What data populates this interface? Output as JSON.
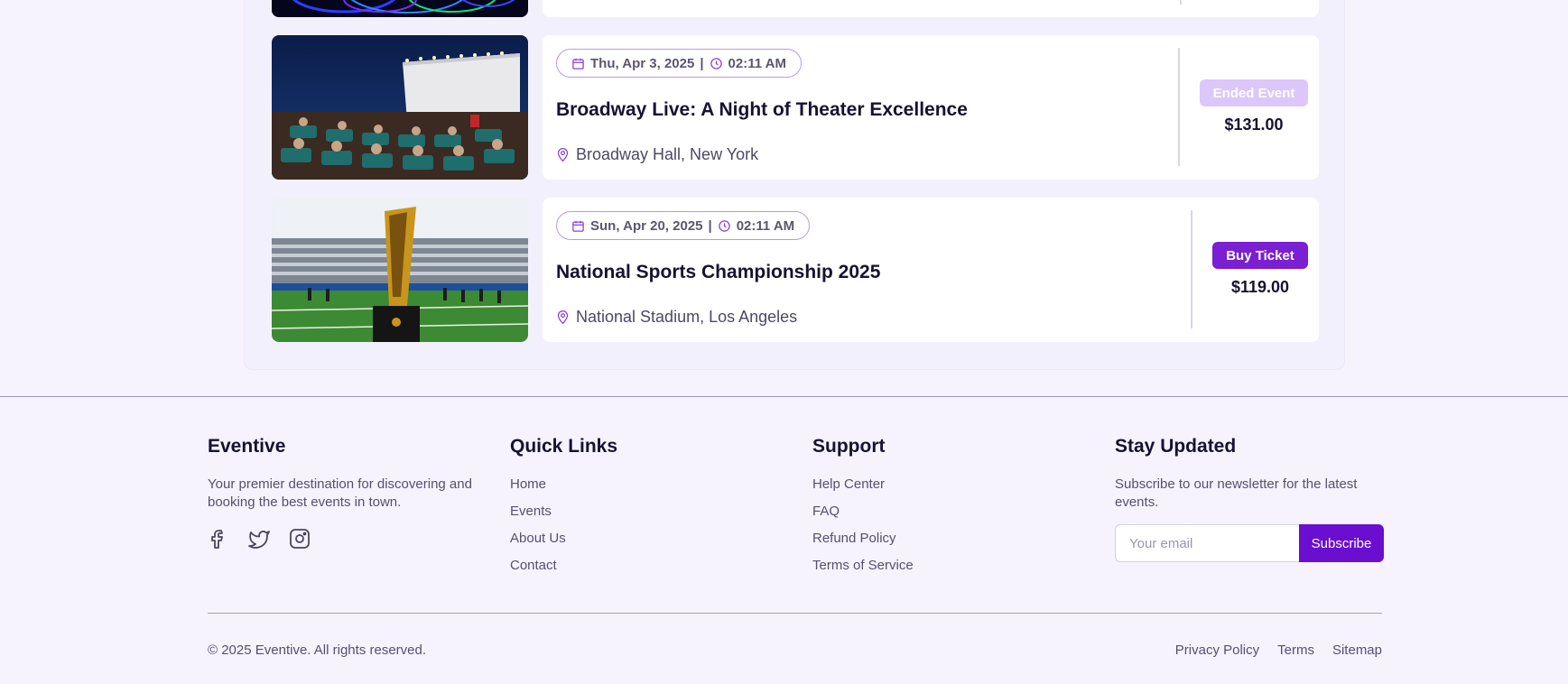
{
  "events": [
    {
      "date": "Thu, Apr 3, 2025",
      "separator": "|",
      "time": "02:11 AM",
      "title": "Broadway Live: A Night of Theater Excellence",
      "location": "Broadway Hall, New York",
      "status_label": "Ended Event",
      "price": "$131.00"
    },
    {
      "date": "Sun, Apr 20, 2025",
      "separator": "|",
      "time": "02:11 AM",
      "title": "National Sports Championship 2025",
      "location": "National Stadium, Los Angeles",
      "status_label": "Buy Ticket",
      "price": "$119.00"
    }
  ],
  "footer": {
    "brand": {
      "title": "Eventive",
      "description": "Your premier destination for discovering and booking the best events in town.",
      "social": [
        "facebook-icon",
        "twitter-icon",
        "instagram-icon"
      ]
    },
    "quick_links": {
      "title": "Quick Links",
      "items": [
        "Home",
        "Events",
        "About Us",
        "Contact"
      ]
    },
    "support": {
      "title": "Support",
      "items": [
        "Help Center",
        "FAQ",
        "Refund Policy",
        "Terms of Service"
      ]
    },
    "newsletter": {
      "title": "Stay Updated",
      "description": "Subscribe to our newsletter for the latest events.",
      "placeholder": "Your email",
      "button_label": "Subscribe"
    },
    "copyright": "© 2025 Eventive. All rights reserved.",
    "bottom_links": [
      "Privacy Policy",
      "Terms",
      "Sitemap"
    ]
  },
  "colors": {
    "accent": "#7a1fd1",
    "accent_light": "#dcc6fa",
    "background": "#f6f3fe"
  }
}
